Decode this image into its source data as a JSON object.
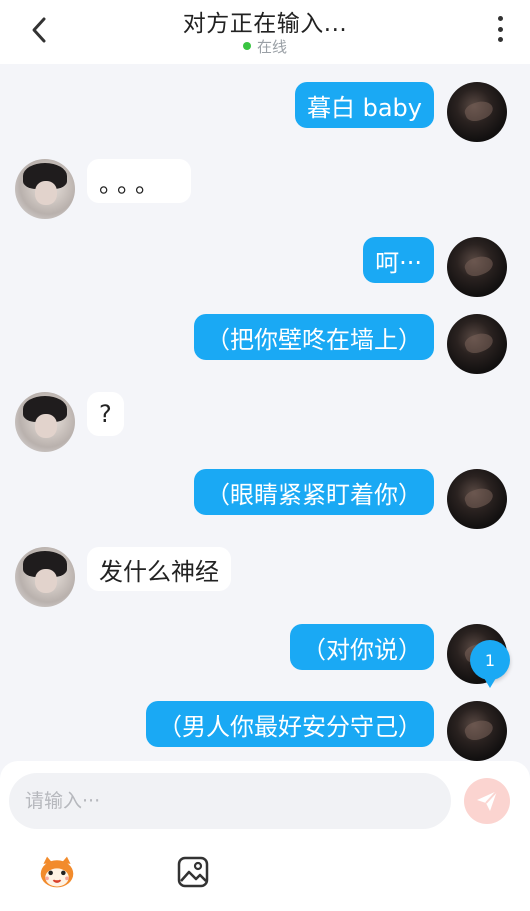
{
  "header": {
    "title": "对方正在输入...",
    "status": "在线"
  },
  "messages": [
    {
      "from": "me",
      "text": "暮白 baby"
    },
    {
      "from": "other",
      "text": "。。。"
    },
    {
      "from": "me",
      "text": "呵···"
    },
    {
      "from": "me",
      "text": "（把你壁咚在墙上）"
    },
    {
      "from": "other",
      "text": "?"
    },
    {
      "from": "me",
      "text": "（眼睛紧紧盯着你）"
    },
    {
      "from": "other",
      "text": "发什么神经"
    },
    {
      "from": "me",
      "text": "（对你说）"
    },
    {
      "from": "me",
      "text": "（男人你最好安分守己）"
    }
  ],
  "unread_badge": "1",
  "composer": {
    "placeholder": "请输入···"
  },
  "colors": {
    "accent": "#1aa9f4",
    "online": "#39c441",
    "send_button": "#fbd4d0"
  }
}
